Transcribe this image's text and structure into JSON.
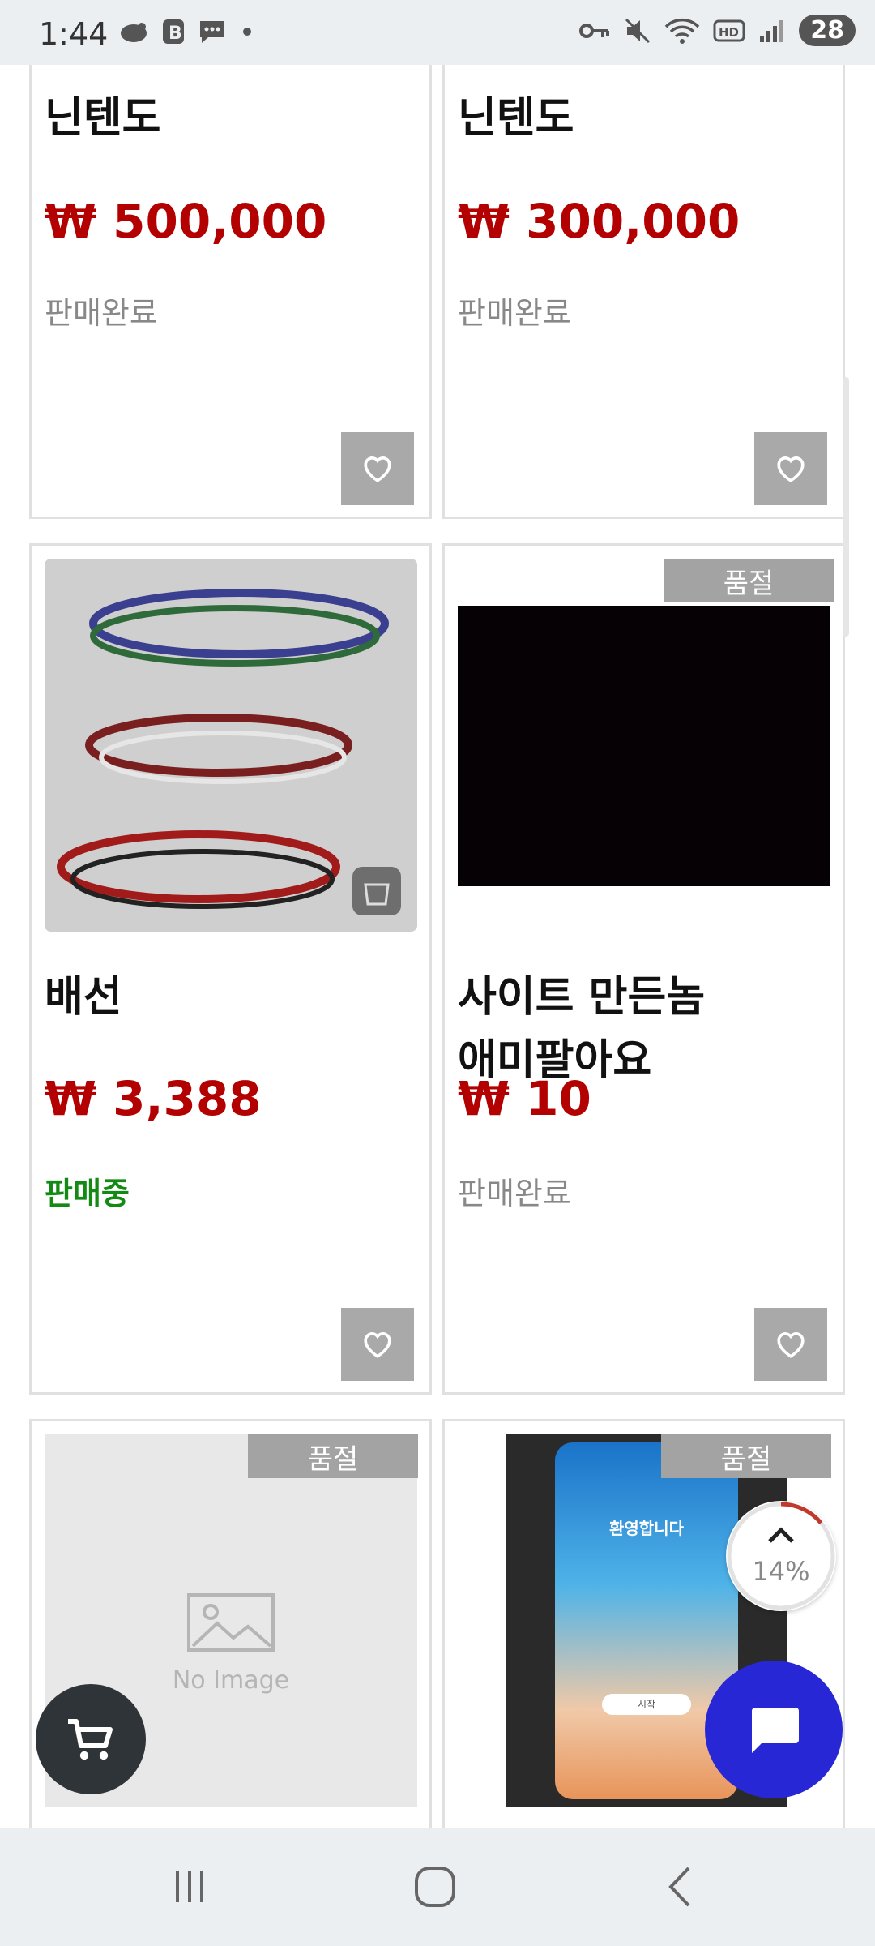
{
  "status_bar": {
    "time": "1:44",
    "battery": "28"
  },
  "products": [
    {
      "title": "닌텐도",
      "price": "₩ 500,000",
      "status": "판매완료"
    },
    {
      "title": "닌텐도",
      "price": "₩ 300,000",
      "status": "판매완료"
    },
    {
      "title": "배선",
      "price": "₩ 3,388",
      "status": "판매중"
    },
    {
      "title_line1": "사이트 만든놈",
      "title_line2": "애미팔아요",
      "price": "₩ 10",
      "status": "판매완료",
      "badge": "품절"
    },
    {
      "badge": "품절",
      "no_image_text": "No Image"
    },
    {
      "badge": "품절",
      "phone_screen_text": "환영합니다",
      "phone_button_text": "시작"
    }
  ],
  "scroll_top": {
    "percent": "14%"
  },
  "colors": {
    "price": "#b30000",
    "selling": "#138a13",
    "chat": "#2727d6",
    "soldout_badge": "#a3a3a3"
  },
  "icons": [
    "heart-icon",
    "cart-icon",
    "chat-icon",
    "chevron-up-icon",
    "recents-icon",
    "home-icon",
    "back-icon"
  ]
}
